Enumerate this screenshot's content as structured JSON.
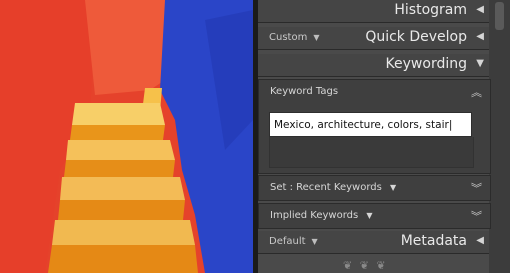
{
  "panels": {
    "histogram": {
      "title": "Histogram"
    },
    "quick_develop": {
      "title": "Quick Develop",
      "preset": "Custom"
    },
    "keywording": {
      "title": "Keywording",
      "keyword_tags": {
        "label": "Keyword Tags",
        "value": "Mexico, architecture, colors, stair"
      },
      "set": {
        "prefix": "Set :",
        "value": "Recent Keywords"
      },
      "implied": {
        "label": "Implied Keywords"
      }
    },
    "metadata": {
      "title": "Metadata",
      "preset": "Default"
    }
  },
  "icons": {
    "collapse": "triangle-left-icon",
    "expand": "triangle-down-icon",
    "dropdown": "caret-down-icon",
    "double_chevron_up": "double-chevron-up-icon",
    "double_chevron_down": "double-chevron-down-icon"
  },
  "colors": {
    "panel_bg": "#4a4a4a",
    "header_bg": "#454545",
    "field_bg": "#ffffff",
    "photo_red": "#e63f2a",
    "photo_blue": "#2a45c8",
    "photo_orange": "#f0a21c"
  }
}
